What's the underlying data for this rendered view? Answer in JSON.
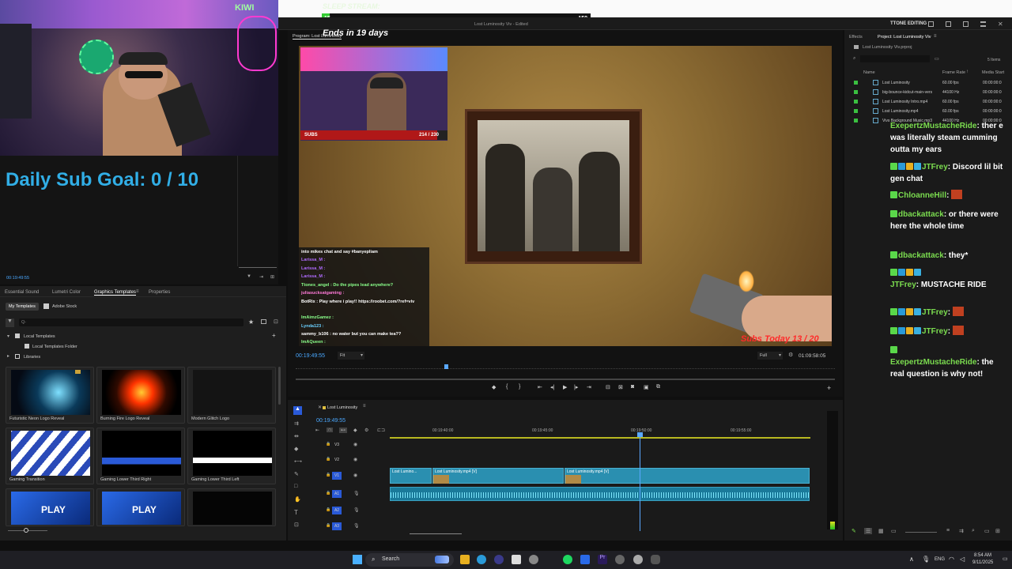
{
  "stream": {
    "banner_title": "SLEEP STREAM:",
    "banner_left": "15",
    "banner_right": "150",
    "ends_in": "Ends in 19 days",
    "goal_text": "Daily Sub Goal:  0 / 10",
    "overlay_subs_label": "SUBS",
    "overlay_subs_value": "214 / 230",
    "overlay_subs_progress": 0.93,
    "subs_today": "Subs Today 13 / 20",
    "webcam_sign": "KIWI"
  },
  "premiere": {
    "workspace": "TTONE EDITING",
    "program_label": "Program: Lost Luminosity",
    "sequence_title": "Lost Luminosity Viv - Edited",
    "current_time": "00:19:49:55",
    "duration": "01:09:58:05",
    "fit": "Fit",
    "full": "Full",
    "source_time": "00:19:49:55",
    "timeline_tab": "Lost Luminosity",
    "timeline_time": "00:19:49:55",
    "ruler": [
      "00:19:40:00",
      "00:19:45:00",
      "00:19:50:00",
      "00:19:55:00"
    ],
    "tracks": [
      "V3",
      "V2",
      "V1",
      "A1",
      "A2",
      "A3"
    ],
    "clips": [
      {
        "label": "Lost Lumino..."
      },
      {
        "label": "Lost Luminosity.mp4 [V]"
      },
      {
        "label": "Lost Luminosity.mp4 [V]"
      }
    ]
  },
  "graphics": {
    "tabs": [
      "Essential Sound",
      "Lumetri Color",
      "Graphics Templates",
      "Properties"
    ],
    "subtabs": [
      "My Templates",
      "Adobe Stock"
    ],
    "search_placeholder": "Q-",
    "tree": [
      {
        "label": "Local Templates"
      },
      {
        "label": "Local Templates Folder"
      },
      {
        "label": "Libraries"
      }
    ],
    "templates": [
      "Futuristic Neon Logo Reveal",
      "Burning Fire Logo Reveal",
      "Modern Glitch Logo",
      "Gaming Transition",
      "Gaming Lower Third Right",
      "Gaming Lower Third Left",
      "",
      "",
      ""
    ],
    "thumb_texts": [
      "PLAY",
      "PLAY"
    ]
  },
  "project": {
    "tabs": [
      "Effects",
      "Project: Lost Luminosity Viv"
    ],
    "file": "Lost Luminosity Viv.prproj",
    "items_count": "5 Items",
    "columns": [
      "Name",
      "Frame Rate",
      "Media Start"
    ],
    "rows": [
      {
        "name": "Lost Luminosity",
        "rate": "60.00 fps",
        "start": "00:00:00:0"
      },
      {
        "name": "big-bounce-kidcut-main-vers",
        "rate": "44100 Hz",
        "start": "00:00:00:0"
      },
      {
        "name": "Lost Luminosity Intro.mp4",
        "rate": "60.00 fps",
        "start": "00:00:00:0"
      },
      {
        "name": "Lost Luminosity.mp4",
        "rate": "60.00 fps",
        "start": "00:00:00:0"
      },
      {
        "name": "Vivs Background Music.mp3",
        "rate": "44100 Hz",
        "start": "00:00:00:0"
      }
    ]
  },
  "overlay_chat": [
    {
      "text": "into mikes chat and say #banyepliam",
      "color": "#ffffff"
    },
    {
      "text": "Larissa_M : ",
      "color": "#b06bff"
    },
    {
      "text": "Larissa_M : ",
      "color": "#b06bff"
    },
    {
      "text": "Larissa_M : ",
      "color": "#b06bff"
    },
    {
      "text": "Ttones_angel : Do the pipes lead anywhere?",
      "color": "#8aff8a"
    },
    {
      "text": "juliasucksatgaming : ",
      "color": "#ff7ad9"
    },
    {
      "text": "BotRix : Play where i play!! https://roobet.com/?ref=viv",
      "color": "#ffffff"
    },
    {
      "text": "ImAimzGamez : ",
      "color": "#8aff8a"
    },
    {
      "text": "Lynda123 : ",
      "color": "#6bd0ff"
    },
    {
      "text": "sammy_b106 : no water but you can make tea??",
      "color": "#ffffff"
    },
    {
      "text": "ImAQueen : ",
      "color": "#8aff8a"
    }
  ],
  "chat": [
    {
      "user": "ExepertzMustacheRide",
      "msg": ": ther e was literally steam cumming outta my ears"
    },
    {
      "user": "JTFrey",
      "msg": ": Discord lil bit gen chat"
    },
    {
      "user": "ChloanneHill",
      "msg": ":"
    },
    {
      "user": "dbackattack",
      "msg": ": or there were here the whole time"
    },
    {
      "user": "dbackattack",
      "msg": ": they*"
    },
    {
      "user": "JTFrey",
      "msg": ": MUSTACHE RIDE"
    },
    {
      "user": "JTFrey",
      "msg": ":"
    },
    {
      "user": "JTFrey",
      "msg": ":"
    },
    {
      "user": "ExepertzMustacheRide",
      "msg": ": the real question is why not!"
    }
  ],
  "taskbar": {
    "search": "Search",
    "lang": "ENG",
    "time": "8:54 AM",
    "date": "9/11/2025"
  },
  "colors": {
    "accent_blue": "#31aee6",
    "chat_user": "#7bdc4f",
    "clip_blue": "#2a8fb0",
    "playhead": "#5aa8ff"
  }
}
